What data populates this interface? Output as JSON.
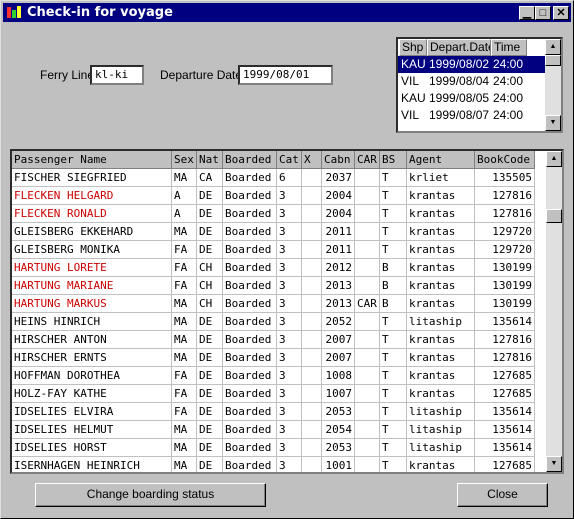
{
  "window": {
    "title": "Check-in for voyage"
  },
  "form": {
    "ferry_line_label": "Ferry Line:",
    "ferry_line_value": "kl-ki",
    "departure_date_label": "Departure Date:",
    "departure_date_value": "1999/08/01"
  },
  "voyages": {
    "headers": [
      "Shp",
      "Depart.Date",
      "Time"
    ],
    "rows": [
      {
        "shp": "KAU",
        "date": "1999/08/02",
        "time": "24:00",
        "selected": true
      },
      {
        "shp": "VIL",
        "date": "1999/08/04",
        "time": "24:00",
        "selected": false
      },
      {
        "shp": "KAU",
        "date": "1999/08/05",
        "time": "24:00",
        "selected": false
      },
      {
        "shp": "VIL",
        "date": "1999/08/07",
        "time": "24:00",
        "selected": false
      }
    ]
  },
  "passengers": {
    "headers": [
      "Passenger Name",
      "Sex",
      "Nat",
      "Boarded",
      "Cat",
      "X",
      "Cabn",
      "CAR",
      "BS",
      "Agent",
      "BookCode"
    ],
    "rows": [
      {
        "name": "FISCHER SIEGFRIED",
        "sex": "MA",
        "nat": "CA",
        "boarded": "Boarded",
        "cat": "6",
        "x": "",
        "cabn": "2037",
        "car": "",
        "bs": "T",
        "agent": "krliet",
        "bookcode": "135505",
        "highlight": false
      },
      {
        "name": "FLECKEN HELGARD",
        "sex": "A",
        "nat": "DE",
        "boarded": "Boarded",
        "cat": "3",
        "x": "",
        "cabn": "2004",
        "car": "",
        "bs": "T",
        "agent": "krantas",
        "bookcode": "127816",
        "highlight": true
      },
      {
        "name": "FLECKEN RONALD",
        "sex": "A",
        "nat": "DE",
        "boarded": "Boarded",
        "cat": "3",
        "x": "",
        "cabn": "2004",
        "car": "",
        "bs": "T",
        "agent": "krantas",
        "bookcode": "127816",
        "highlight": true
      },
      {
        "name": "GLEISBERG EKKEHARD",
        "sex": "MA",
        "nat": "DE",
        "boarded": "Boarded",
        "cat": "3",
        "x": "",
        "cabn": "2011",
        "car": "",
        "bs": "T",
        "agent": "krantas",
        "bookcode": "129720",
        "highlight": false
      },
      {
        "name": "GLEISBERG MONIKA",
        "sex": "FA",
        "nat": "DE",
        "boarded": "Boarded",
        "cat": "3",
        "x": "",
        "cabn": "2011",
        "car": "",
        "bs": "T",
        "agent": "krantas",
        "bookcode": "129720",
        "highlight": false
      },
      {
        "name": "HARTUNG LORETE",
        "sex": "FA",
        "nat": "CH",
        "boarded": "Boarded",
        "cat": "3",
        "x": "",
        "cabn": "2012",
        "car": "",
        "bs": "B",
        "agent": "krantas",
        "bookcode": "130199",
        "highlight": true
      },
      {
        "name": "HARTUNG MARIANE",
        "sex": "FA",
        "nat": "CH",
        "boarded": "Boarded",
        "cat": "3",
        "x": "",
        "cabn": "2013",
        "car": "",
        "bs": "B",
        "agent": "krantas",
        "bookcode": "130199",
        "highlight": true
      },
      {
        "name": "HARTUNG MARKUS",
        "sex": "MA",
        "nat": "CH",
        "boarded": "Boarded",
        "cat": "3",
        "x": "",
        "cabn": "2013",
        "car": "CAR",
        "bs": "B",
        "agent": "krantas",
        "bookcode": "130199",
        "highlight": true
      },
      {
        "name": "HEINS HINRICH",
        "sex": "MA",
        "nat": "DE",
        "boarded": "Boarded",
        "cat": "3",
        "x": "",
        "cabn": "2052",
        "car": "",
        "bs": "T",
        "agent": "litaship",
        "bookcode": "135614",
        "highlight": false
      },
      {
        "name": "HIRSCHER ANTON",
        "sex": "MA",
        "nat": "DE",
        "boarded": "Boarded",
        "cat": "3",
        "x": "",
        "cabn": "2007",
        "car": "",
        "bs": "T",
        "agent": "krantas",
        "bookcode": "127816",
        "highlight": false
      },
      {
        "name": "HIRSCHER ERNTS",
        "sex": "MA",
        "nat": "DE",
        "boarded": "Boarded",
        "cat": "3",
        "x": "",
        "cabn": "2007",
        "car": "",
        "bs": "T",
        "agent": "krantas",
        "bookcode": "127816",
        "highlight": false
      },
      {
        "name": "HOFFMAN DOROTHEA",
        "sex": "FA",
        "nat": "DE",
        "boarded": "Boarded",
        "cat": "3",
        "x": "",
        "cabn": "1008",
        "car": "",
        "bs": "T",
        "agent": "krantas",
        "bookcode": "127685",
        "highlight": false
      },
      {
        "name": "HOLZ-FAY KATHE",
        "sex": "FA",
        "nat": "DE",
        "boarded": "Boarded",
        "cat": "3",
        "x": "",
        "cabn": "1007",
        "car": "",
        "bs": "T",
        "agent": "krantas",
        "bookcode": "127685",
        "highlight": false
      },
      {
        "name": "IDSELIES ELVIRA",
        "sex": "FA",
        "nat": "DE",
        "boarded": "Boarded",
        "cat": "3",
        "x": "",
        "cabn": "2053",
        "car": "",
        "bs": "T",
        "agent": "litaship",
        "bookcode": "135614",
        "highlight": false
      },
      {
        "name": "IDSELIES HELMUT",
        "sex": "MA",
        "nat": "DE",
        "boarded": "Boarded",
        "cat": "3",
        "x": "",
        "cabn": "2054",
        "car": "",
        "bs": "T",
        "agent": "litaship",
        "bookcode": "135614",
        "highlight": false
      },
      {
        "name": "IDSELIES HORST",
        "sex": "MA",
        "nat": "DE",
        "boarded": "Boarded",
        "cat": "3",
        "x": "",
        "cabn": "2053",
        "car": "",
        "bs": "T",
        "agent": "litaship",
        "bookcode": "135614",
        "highlight": false
      },
      {
        "name": "ISERNHAGEN HEINRICH",
        "sex": "MA",
        "nat": "DE",
        "boarded": "Boarded",
        "cat": "3",
        "x": "",
        "cabn": "1001",
        "car": "",
        "bs": "T",
        "agent": "krantas",
        "bookcode": "127685",
        "highlight": false
      }
    ]
  },
  "buttons": {
    "change_status": "Change boarding status",
    "close": "Close"
  },
  "icons": {
    "minimize": "minimize-icon",
    "maximize": "maximize-icon",
    "close": "close-icon",
    "scroll_up": "scroll-up-icon",
    "scroll_down": "scroll-down-icon"
  },
  "colors": {
    "titlebar": "#000080",
    "selection": "#000080",
    "highlight_text": "#cc0000",
    "window_bg": "#c0c0c0"
  }
}
